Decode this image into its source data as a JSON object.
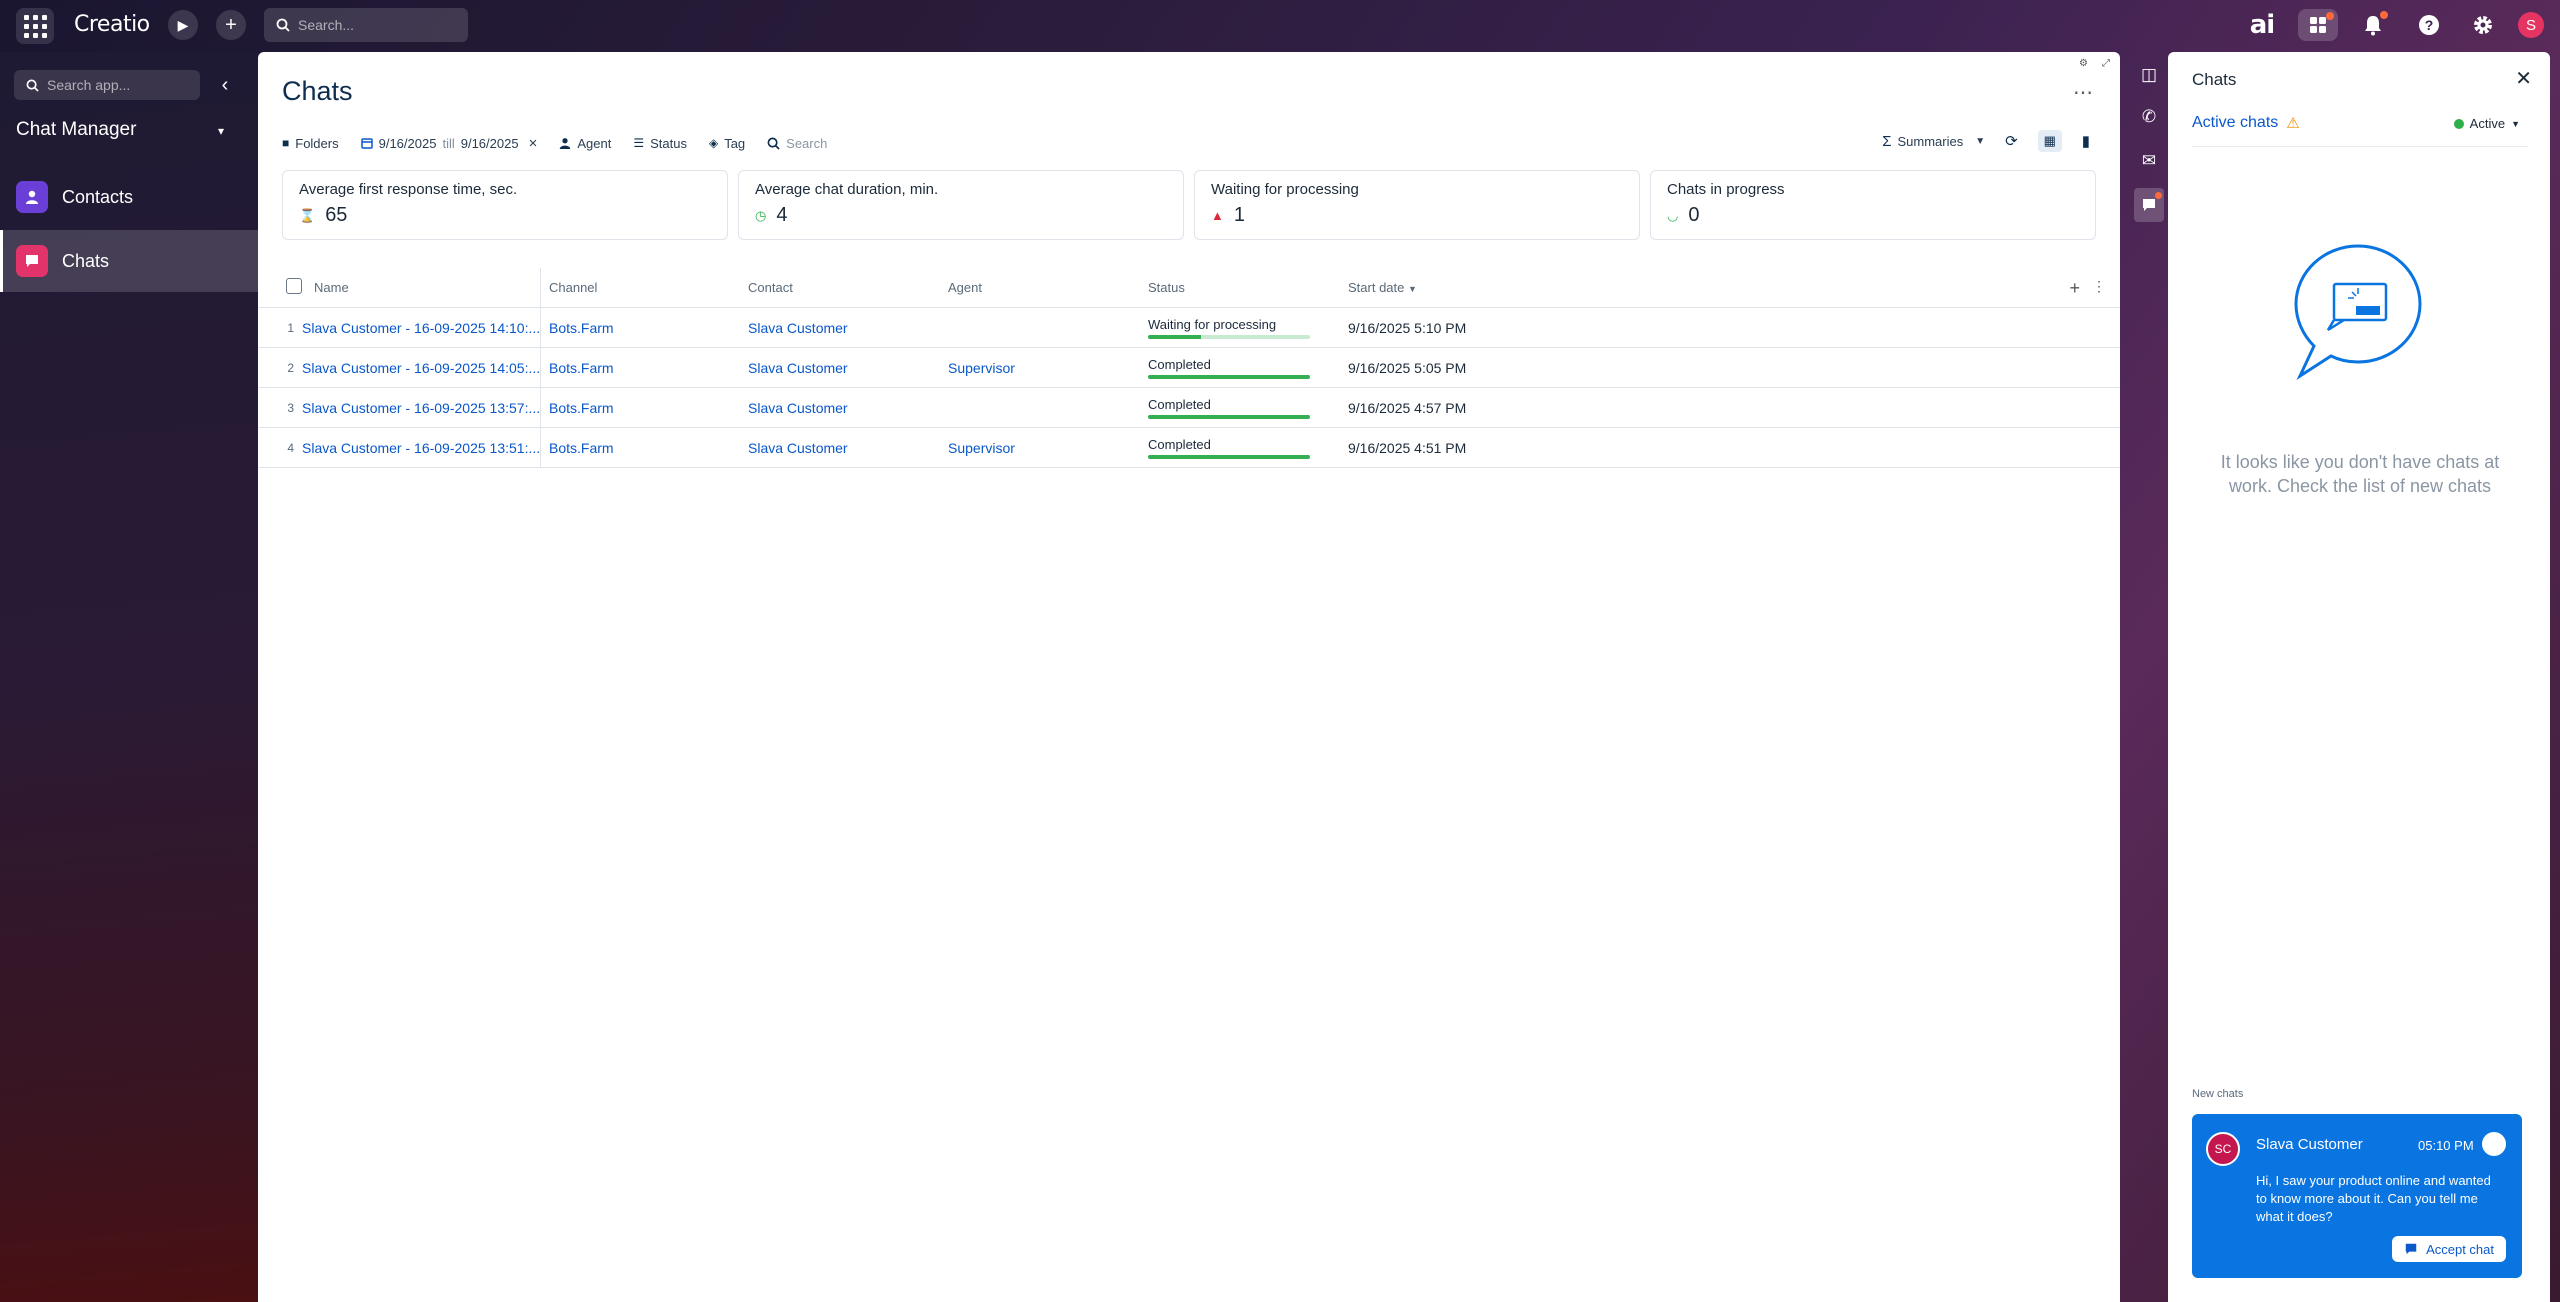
{
  "topbar": {
    "logo": "Creatio",
    "search_placeholder": "Search...",
    "ai_label": "ai",
    "user_initial": "S"
  },
  "nav": {
    "search_placeholder": "Search app...",
    "title": "Chat Manager",
    "items": [
      {
        "label": "Contacts",
        "icon": "contact-icon",
        "color": "#6a3fd8"
      },
      {
        "label": "Chats",
        "icon": "chat-icon",
        "color": "#e2336a",
        "active": true
      }
    ]
  },
  "page": {
    "title": "Chats",
    "toolbar": {
      "folders": "Folders",
      "date_from": "9/16/2025",
      "date_till_word": "till",
      "date_to": "9/16/2025",
      "agent": "Agent",
      "status": "Status",
      "tag": "Tag",
      "search_placeholder": "Search",
      "summaries": "Summaries"
    },
    "kpis": [
      {
        "label": "Average first response time, sec.",
        "value": "65",
        "icon": "hourglass-icon",
        "color": "#0a58ca"
      },
      {
        "label": "Average chat duration, min.",
        "value": "4",
        "icon": "clock-icon",
        "color": "#2eaf48"
      },
      {
        "label": "Waiting for processing",
        "value": "1",
        "icon": "bell-icon",
        "color": "#e0283a"
      },
      {
        "label": "Chats in progress",
        "value": "0",
        "icon": "progress-icon",
        "color": "#2eaf48"
      }
    ],
    "table": {
      "columns": [
        "Name",
        "Channel",
        "Contact",
        "Agent",
        "Status",
        "Start date"
      ],
      "rows": [
        {
          "num": "1",
          "name": "Slava Customer - 16-09-2025 14:10:...",
          "channel": "Bots.Farm",
          "contact": "Slava Customer",
          "agent": "",
          "status": "Waiting for processing",
          "progress": 0.33,
          "date": "9/16/2025 5:10 PM"
        },
        {
          "num": "2",
          "name": "Slava Customer - 16-09-2025 14:05:...",
          "channel": "Bots.Farm",
          "contact": "Slava Customer",
          "agent": "Supervisor",
          "status": "Completed",
          "progress": 1.0,
          "date": "9/16/2025 5:05 PM"
        },
        {
          "num": "3",
          "name": "Slava Customer - 16-09-2025 13:57:...",
          "channel": "Bots.Farm",
          "contact": "Slava Customer",
          "agent": "",
          "status": "Completed",
          "progress": 1.0,
          "date": "9/16/2025 4:57 PM"
        },
        {
          "num": "4",
          "name": "Slava Customer - 16-09-2025 13:51:...",
          "channel": "Bots.Farm",
          "contact": "Slava Customer",
          "agent": "Supervisor",
          "status": "Completed",
          "progress": 1.0,
          "date": "9/16/2025 4:51 PM"
        }
      ]
    }
  },
  "comm": {
    "title": "Chats",
    "active_chats": "Active chats",
    "presence": "Active",
    "empty_text": "It looks like you don't have chats at work. Check the list of new chats",
    "new_chats_label": "New chats",
    "card": {
      "initials": "SC",
      "name": "Slava Customer",
      "time": "05:10 PM",
      "message": "Hi, I saw your product online and wanted to know more about it. Can you tell me what it does?",
      "accept": "Accept chat"
    }
  }
}
